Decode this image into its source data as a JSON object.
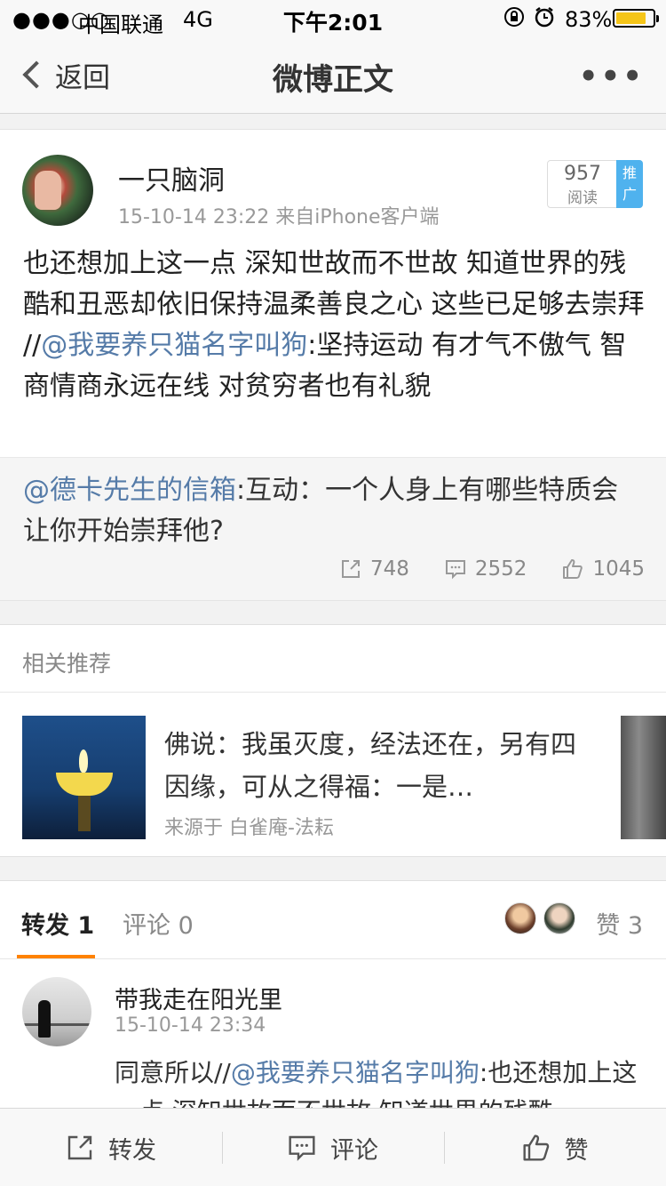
{
  "status_bar": {
    "signal": "●●●○○",
    "carrier": "中国联通",
    "network": "4G",
    "time": "下午2:01",
    "battery": "83%",
    "battery_level": 0.83
  },
  "nav": {
    "back_label": "返回",
    "title": "微博正文",
    "more": "•••"
  },
  "post": {
    "username": "一只脑洞",
    "meta": "15-10-14 23:22  来自iPhone客户端",
    "read_count": "957",
    "read_label": "阅读",
    "promote_label": "推广",
    "text_before": "也还想加上这一点 深知世故而不世故 知道世界的残酷和丑恶却依旧保持温柔善良之心 这些已足够去崇拜 //",
    "mention": "@我要养只猫名字叫狗",
    "text_after": ":坚持运动 有才气不傲气 智商情商永远在线 对贫穷者也有礼貌",
    "repost": {
      "mention": "@德卡先生的信箱",
      "text": ":互动：一个人身上有哪些特质会让你开始崇拜他?"
    },
    "stats": {
      "reposts": "748",
      "comments": "2552",
      "likes": "1045"
    }
  },
  "related": {
    "title": "相关推荐",
    "item_text": "佛说：我虽灭度，经法还在，另有四因缘，可从之得福：一是…",
    "item_source": "来源于 白雀庵-法耘"
  },
  "tabs": {
    "repost_label": "转发",
    "repost_count": "1",
    "comment_label": "评论",
    "comment_count": "0",
    "like_label": "赞",
    "like_count": "3"
  },
  "comment": {
    "name": "带我走在阳光里",
    "time": "15-10-14 23:34",
    "text_before": "同意所以//",
    "mention": "@我要养只猫名字叫狗",
    "text_after": ":也还想加上这一点 深知世故而不世故 知道世界的残酷"
  },
  "toolbar": {
    "repost_label": "转发",
    "comment_label": "评论",
    "like_label": "赞"
  },
  "colors": {
    "accent": "#ff8200",
    "link": "#557ba8",
    "promote": "#4fb2ee"
  }
}
